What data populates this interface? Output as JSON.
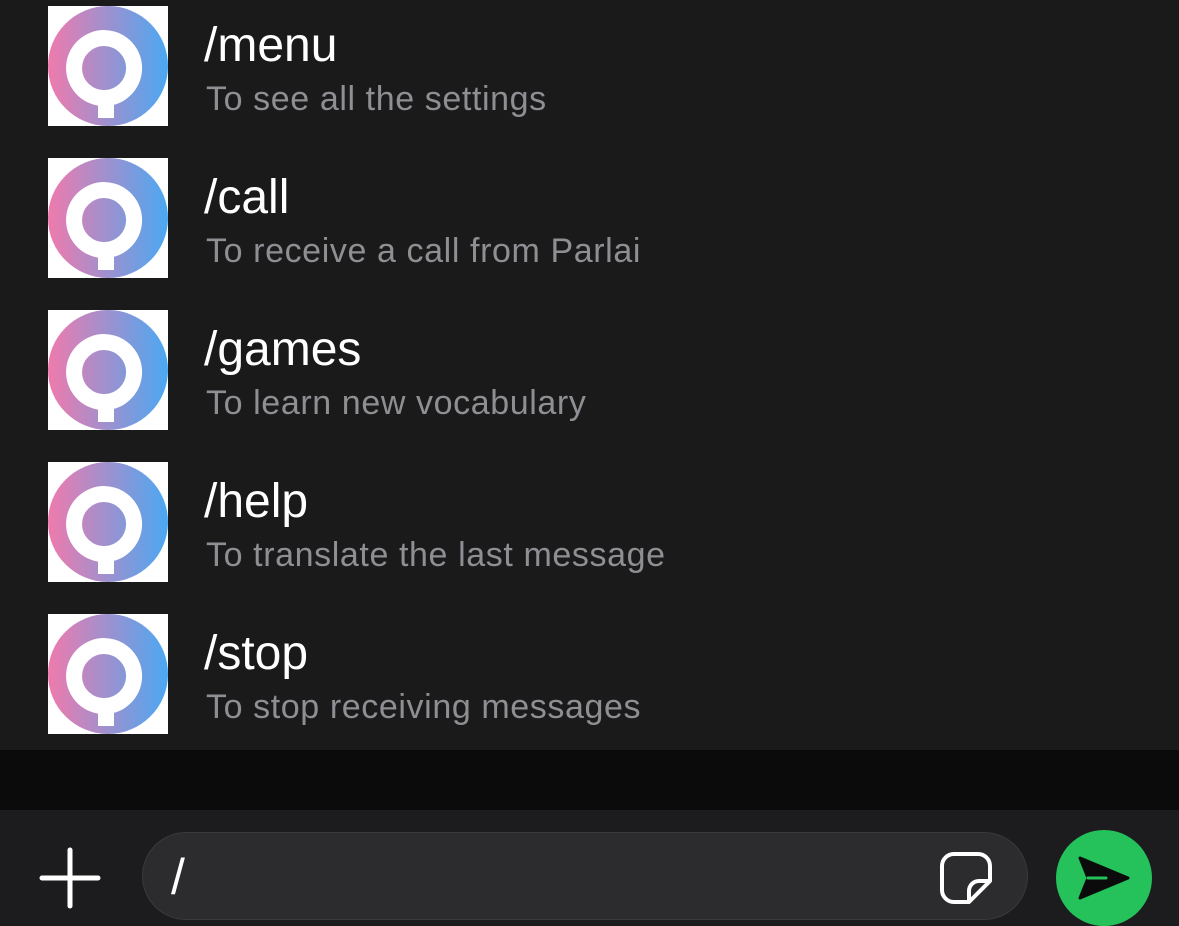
{
  "commands": [
    {
      "title": "/menu",
      "description": "To see all the settings",
      "icon": "parlai-logo-icon"
    },
    {
      "title": "/call",
      "description": "To receive a call from Parlai",
      "icon": "parlai-logo-icon"
    },
    {
      "title": "/games",
      "description": "To learn new vocabulary",
      "icon": "parlai-logo-icon"
    },
    {
      "title": "/help",
      "description": "To translate the last message",
      "icon": "parlai-logo-icon"
    },
    {
      "title": "/stop",
      "description": "To stop receiving messages",
      "icon": "parlai-logo-icon"
    }
  ],
  "composer": {
    "input_value": "/",
    "attach_icon": "plus-icon",
    "sticker_icon": "sticker-icon",
    "send_icon": "send-icon"
  },
  "colors": {
    "background": "#1a1a1a",
    "title_text": "#ffffff",
    "description_text": "#8e8e93",
    "send_button": "#25c15a",
    "logo_gradient_start": "#f07aac",
    "logo_gradient_end": "#4aa8f2"
  }
}
